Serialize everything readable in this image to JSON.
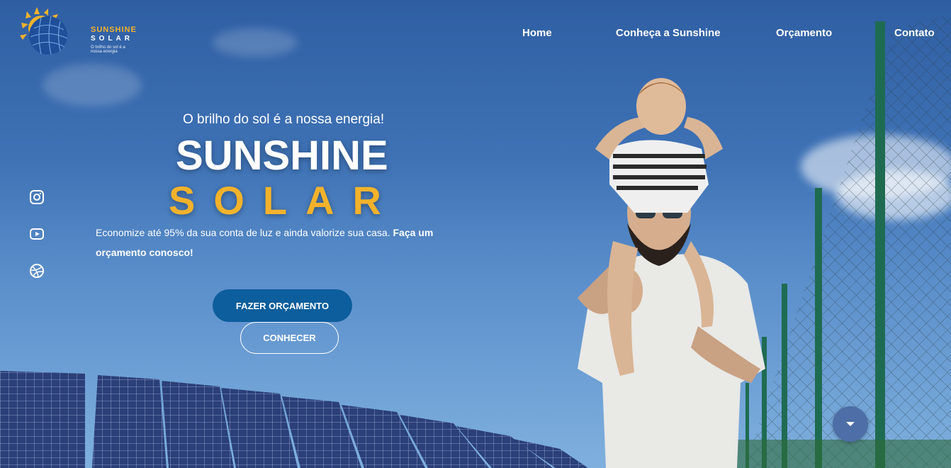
{
  "logo": {
    "line1": "SUNSHINE",
    "line2": "SOLAR",
    "slogan": "O brilho do sol é a nossa energia",
    "icon": "sun-globe-logo"
  },
  "nav": {
    "items": [
      {
        "label": "Home"
      },
      {
        "label": "Conheça a Sunshine"
      },
      {
        "label": "Orçamento"
      },
      {
        "label": "Contato"
      }
    ]
  },
  "social": {
    "items": [
      {
        "icon": "instagram-icon"
      },
      {
        "icon": "youtube-icon"
      },
      {
        "icon": "dribbble-icon"
      }
    ]
  },
  "hero": {
    "tagline": "O brilho do sol é a nossa energia!",
    "title_line1": "SUNSHINE",
    "title_line2": "SOLAR",
    "description": "Economize até 95% da sua conta de luz e ainda valorize sua casa.",
    "description_bold": "Faça um orçamento conosco!",
    "primary_button": "FAZER ORÇAMENTO",
    "secondary_button": "CONHECER"
  },
  "scroll": {
    "icon": "chevron-down-icon"
  },
  "colors": {
    "accent": "#f3b22c",
    "primary": "#0d5e9c",
    "sky": "#3f73b6",
    "fence": "#1f6b52"
  }
}
